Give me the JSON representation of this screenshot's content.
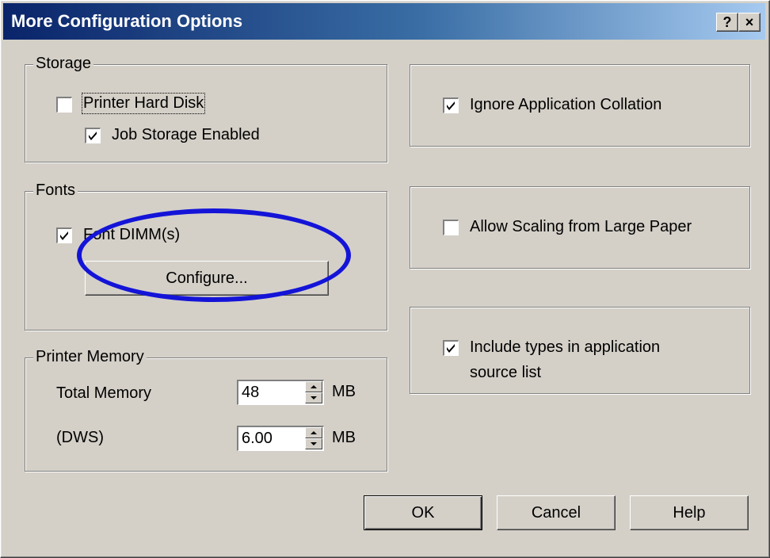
{
  "window": {
    "title": "More Configuration Options",
    "help_button": "?",
    "close_button": "×"
  },
  "storage": {
    "group_label": "Storage",
    "printer_hard_disk": {
      "label": "Printer Hard Disk",
      "checked": false
    },
    "job_storage_enabled": {
      "label": "Job Storage Enabled",
      "checked": true
    }
  },
  "fonts": {
    "group_label": "Fonts",
    "font_dimm": {
      "label": "Font DIMM(s)",
      "checked": true
    },
    "configure_button": "Configure..."
  },
  "printer_memory": {
    "group_label": "Printer Memory",
    "total_memory": {
      "label": "Total Memory",
      "value": "48",
      "unit": "MB"
    },
    "dws": {
      "label": "(DWS)",
      "value": "6.00",
      "unit": "MB"
    }
  },
  "options": {
    "ignore_application_collation": {
      "label": "Ignore Application Collation",
      "checked": true
    },
    "allow_scaling": {
      "label": "Allow Scaling from Large Paper",
      "checked": false
    },
    "include_types": {
      "label_line1": "Include types in application",
      "label_line2": "source list",
      "checked": true
    }
  },
  "buttons": {
    "ok": "OK",
    "cancel": "Cancel",
    "help": "Help"
  },
  "colors": {
    "dialog_bg": "#d4d0c8",
    "title_start": "#0a246a",
    "title_end": "#a6caf0",
    "highlight_ellipse": "#1414d8"
  }
}
